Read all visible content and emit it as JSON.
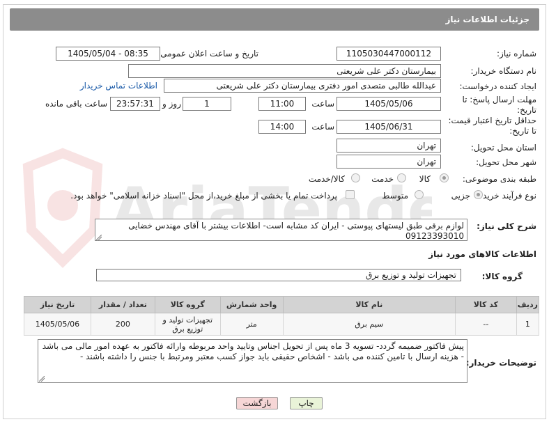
{
  "header": {
    "title": "جزئیات اطلاعات نیاز"
  },
  "watermark": {
    "text": "AriaTender.net"
  },
  "fields": {
    "need_number_label": "شماره نیاز:",
    "need_number": "1105030447000112",
    "announce_label": "تاریخ و ساعت اعلان عمومی:",
    "announce_value": "1405/05/04 - 08:35",
    "buyer_org_label": "نام دستگاه خریدار:",
    "buyer_org": "بیمارستان دکتر علی شریعتی",
    "requester_label": "ایجاد کننده درخواست:",
    "requester": "عبدالله طالبی متصدی امور دفتری بیمارستان دکتر علی شریعتی",
    "contact_link": "اطلاعات تماس خریدار",
    "reply_deadline_label": "مهلت ارسال پاسخ: تا تاریخ:",
    "reply_date": "1405/05/06",
    "time_label": "ساعت",
    "reply_time": "11:00",
    "days_value": "1",
    "days_label": "روز و",
    "remaining_time": "23:57:31",
    "remaining_label": "ساعت باقی مانده",
    "validity_label": "حداقل تاریخ اعتبار قیمت: تا تاریخ:",
    "validity_date": "1405/06/31",
    "validity_time": "14:00",
    "province_label": "استان محل تحویل:",
    "province": "تهران",
    "city_label": "شهر محل تحویل:",
    "city": "تهران",
    "category_label": "طبقه بندی موضوعی:",
    "category_options": [
      "کالا",
      "خدمت",
      "کالا/خدمت"
    ],
    "process_label": "نوع فرآیند خرید :",
    "process_options": [
      "جزیی",
      "متوسط"
    ],
    "payment_note": "پرداخت تمام یا بخشی از مبلغ خرید،از محل \"اسناد خزانه اسلامی\" خواهد بود.",
    "summary_label": "شرح کلی نیاز:",
    "summary": "لوازم برقی طبق لیستهای پیوستی - ایران کد مشابه است- اطلاعات بیشتر با آقای مهندس خضایی 09123393010",
    "goods_info_title": "اطلاعات کالاهای مورد نیاز",
    "goods_group_label": "گروه کالا:",
    "goods_group": "تجهیزات تولید و توزیع برق",
    "buyer_notes_label": "توضیحات خریدار:",
    "buyer_notes": "پیش فاکتور ضمیمه گردد- تسویه 3 ماه پس از تحویل اجناس وتایید واحد مربوطه وارائه فاکتور به عهده امور مالی می باشد - هزینه ارسال با تامین کننده می باشد - اشخاص حقیقی باید جواز کسب معتبر ومرتبط با جنس را داشته باشند -"
  },
  "table": {
    "headers": [
      "ردیف",
      "کد کالا",
      "نام کالا",
      "واحد شمارش",
      "گروه کالا",
      "تعداد / مقدار",
      "تاریخ نیاز"
    ],
    "rows": [
      [
        "1",
        "--",
        "سیم برق",
        "متر",
        "تجهیزات تولید و توزیع برق",
        "200",
        "1405/05/06"
      ]
    ]
  },
  "buttons": {
    "print": "چاپ",
    "back": "بازگشت"
  },
  "colors": {
    "header_bg": "#8c8c8c",
    "link": "#1a5aa8",
    "back_bg": "#f6d6d6",
    "print_bg": "#e9f3d8"
  }
}
